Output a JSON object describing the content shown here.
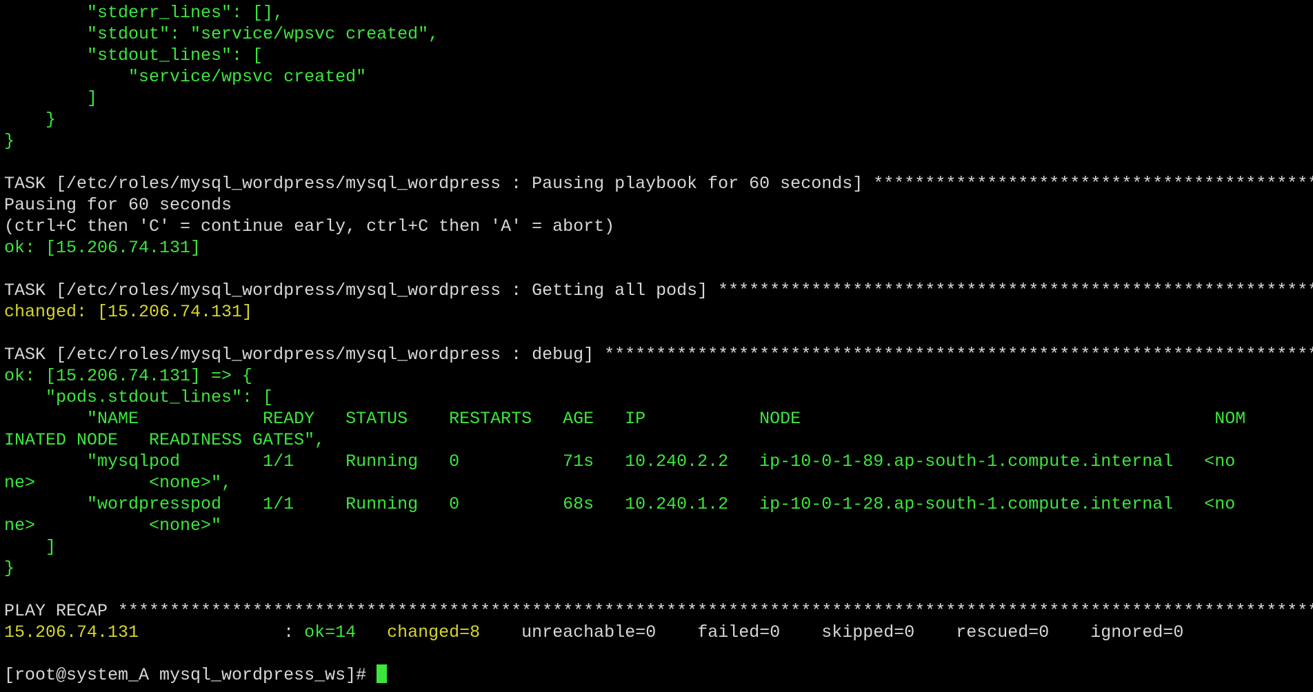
{
  "colors": {
    "background": "#000000",
    "green": "#3ce63c",
    "white": "#d7d7d7",
    "yellow": "#d6d62a",
    "cursor": "#3ce63c"
  },
  "terminal": {
    "lines": [
      {
        "segments": [
          {
            "text": "        \"stderr_lines\": [],",
            "color": "green"
          }
        ]
      },
      {
        "segments": [
          {
            "text": "        \"stdout\": \"service/wpsvc created\",",
            "color": "green"
          }
        ]
      },
      {
        "segments": [
          {
            "text": "        \"stdout_lines\": [",
            "color": "green"
          }
        ]
      },
      {
        "segments": [
          {
            "text": "            \"service/wpsvc created\"",
            "color": "green"
          }
        ]
      },
      {
        "segments": [
          {
            "text": "        ]",
            "color": "green"
          }
        ]
      },
      {
        "segments": [
          {
            "text": "    }",
            "color": "green"
          }
        ]
      },
      {
        "segments": [
          {
            "text": "}",
            "color": "green"
          }
        ]
      },
      {
        "segments": [
          {
            "text": "",
            "color": "white"
          }
        ]
      },
      {
        "segments": [
          {
            "text": "TASK [/etc/roles/mysql_wordpress/mysql_wordpress : Pausing playbook for 60 seconds] ************************************************",
            "color": "white"
          }
        ]
      },
      {
        "segments": [
          {
            "text": "Pausing for 60 seconds",
            "color": "white"
          }
        ]
      },
      {
        "segments": [
          {
            "text": "(ctrl+C then 'C' = continue early, ctrl+C then 'A' = abort)",
            "color": "white"
          }
        ]
      },
      {
        "segments": [
          {
            "text": "ok: [15.206.74.131]",
            "color": "green"
          }
        ]
      },
      {
        "segments": [
          {
            "text": "",
            "color": "white"
          }
        ]
      },
      {
        "segments": [
          {
            "text": "TASK [/etc/roles/mysql_wordpress/mysql_wordpress : Getting all pods] ***************************************************************",
            "color": "white"
          }
        ]
      },
      {
        "segments": [
          {
            "text": "changed: [15.206.74.131]",
            "color": "yellow"
          }
        ]
      },
      {
        "segments": [
          {
            "text": "",
            "color": "white"
          }
        ]
      },
      {
        "segments": [
          {
            "text": "TASK [/etc/roles/mysql_wordpress/mysql_wordpress : debug] **************************************************************************",
            "color": "white"
          }
        ]
      },
      {
        "segments": [
          {
            "text": "ok: [15.206.74.131] => {",
            "color": "green"
          }
        ]
      },
      {
        "segments": [
          {
            "text": "    \"pods.stdout_lines\": [",
            "color": "green"
          }
        ]
      },
      {
        "segments": [
          {
            "text": "        \"NAME            READY   STATUS    RESTARTS   AGE   IP           NODE                                        NOM",
            "color": "green"
          }
        ]
      },
      {
        "segments": [
          {
            "text": "INATED NODE   READINESS GATES\",",
            "color": "green"
          }
        ]
      },
      {
        "segments": [
          {
            "text": "        \"mysqlpod        1/1     Running   0          71s   10.240.2.2   ip-10-0-1-89.ap-south-1.compute.internal   <no",
            "color": "green"
          }
        ]
      },
      {
        "segments": [
          {
            "text": "ne>           <none>\",",
            "color": "green"
          }
        ]
      },
      {
        "segments": [
          {
            "text": "        \"wordpresspod    1/1     Running   0          68s   10.240.1.2   ip-10-0-1-28.ap-south-1.compute.internal   <no",
            "color": "green"
          }
        ]
      },
      {
        "segments": [
          {
            "text": "ne>           <none>\"",
            "color": "green"
          }
        ]
      },
      {
        "segments": [
          {
            "text": "    ]",
            "color": "green"
          }
        ]
      },
      {
        "segments": [
          {
            "text": "}",
            "color": "green"
          }
        ]
      },
      {
        "segments": [
          {
            "text": "",
            "color": "white"
          }
        ]
      },
      {
        "segments": [
          {
            "text": "PLAY RECAP *************************************************************************************************************************",
            "color": "white"
          }
        ]
      },
      {
        "segments": [
          {
            "text": "15.206.74.131",
            "color": "yellow"
          },
          {
            "text": "              : ",
            "color": "white"
          },
          {
            "text": "ok=14",
            "color": "green"
          },
          {
            "text": "   ",
            "color": "white"
          },
          {
            "text": "changed=8",
            "color": "yellow"
          },
          {
            "text": "    unreachable=0    failed=0    skipped=0    rescued=0    ignored=0",
            "color": "white"
          }
        ]
      },
      {
        "segments": [
          {
            "text": "",
            "color": "white"
          }
        ]
      },
      {
        "segments": [
          {
            "text": "[root@system_A mysql_wordpress_ws]# ",
            "color": "white"
          }
        ]
      }
    ]
  }
}
